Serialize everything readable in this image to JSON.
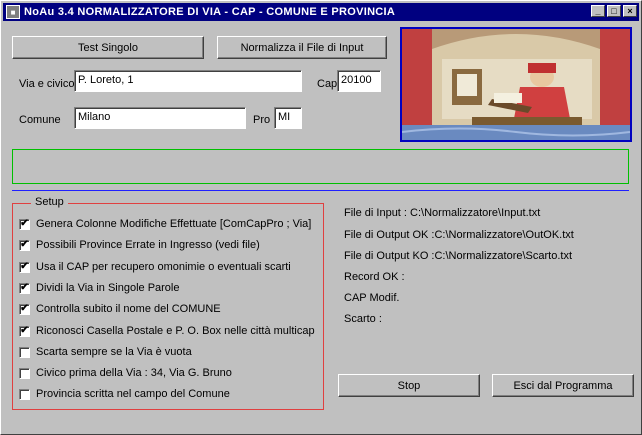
{
  "window": {
    "title": "NoAu 3.4  NORMALIZZATORE DI  VIA - CAP - COMUNE E PROVINCIA",
    "minimize": "_",
    "maximize": "□",
    "close": "×"
  },
  "buttons": {
    "test_singolo": "Test Singolo",
    "normalizza": "Normalizza il File di Input",
    "stop": "Stop",
    "esci": "Esci dal Programma"
  },
  "form": {
    "via_label": "Via e civico",
    "via_value": "P. Loreto, 1",
    "cap_label": "Cap",
    "cap_value": "20100",
    "comune_label": "Comune",
    "comune_value": "Milano",
    "pro_label": "Pro",
    "pro_value": "MI"
  },
  "setup": {
    "legend": "Setup",
    "options": [
      {
        "label": "Genera Colonne Modifiche Effettuate [ComCapPro ; Via]",
        "checked": true
      },
      {
        "label": "Possibili Province Errate in Ingresso (vedi file)",
        "checked": true
      },
      {
        "label": "Usa il CAP per recupero omonimie o eventuali scarti",
        "checked": true
      },
      {
        "label": "Dividi la Via in Singole Parole",
        "checked": true
      },
      {
        "label": "Controlla subito il nome del COMUNE",
        "checked": true
      },
      {
        "label": "Riconosci Casella Postale e P. O. Box nelle città multicap",
        "checked": true
      },
      {
        "label": "Scarta sempre se la Via è vuota",
        "checked": false
      },
      {
        "label": "Civico prima della Via : 34, Via G. Bruno",
        "checked": false
      },
      {
        "label": "Provincia scritta nel campo del Comune",
        "checked": false
      }
    ]
  },
  "info": {
    "input_file": "File di Input : C:\\Normalizzatore\\Input.txt",
    "output_ok": "File di Output OK :C:\\Normalizzatore\\OutOK.txt",
    "output_ko": "File di Output KO :C:\\Normalizzatore\\Scarto.txt",
    "record_ok": "Record OK :",
    "cap_modif": "CAP Modif.",
    "scarto": "Scarto :"
  },
  "colors": {
    "titlebar": "#000080",
    "face": "#c0c0c0",
    "picture_border": "#0000c0",
    "status_border": "#00c000",
    "setup_border": "#e04040"
  }
}
